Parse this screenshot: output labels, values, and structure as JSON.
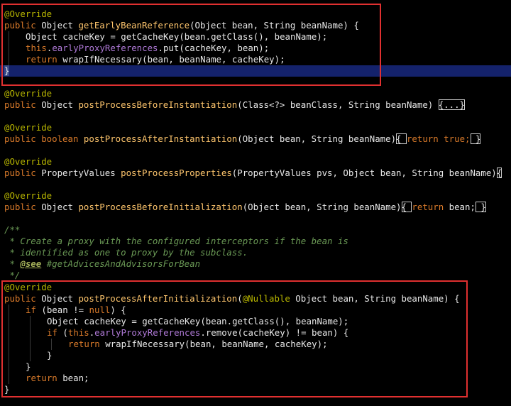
{
  "code": {
    "l1": "@Override",
    "l2_public": "public ",
    "l2_type": "Object ",
    "l2_name": "getEarlyBeanReference",
    "l2_rest": "(Object bean, String beanName) {",
    "l3_a": "Object cacheKey = ",
    "l3_fn": "getCacheKey",
    "l3_b": "(bean.getClass(), beanName);",
    "l4_this": "this",
    "l4_dot": ".",
    "l4_field": "earlyProxyReferences",
    "l4_rest": ".put(cacheKey, bean);",
    "l5_ret": "return ",
    "l5_rest": "wrapIfNecessary(bean, beanName, cacheKey);",
    "l6": "}",
    "l7": "@Override",
    "l8_public": "public ",
    "l8_type": "Object ",
    "l8_name": "postProcessBeforeInstantiation",
    "l8_rest": "(Class<?> beanClass, String beanName) ",
    "l8_fold": "{...}",
    "l9": "@Override",
    "l10_public": "public ",
    "l10_type": "boolean ",
    "l10_name": "postProcessAfterInstantiation",
    "l10_rest": "(Object bean, String beanName)",
    "l10_fold1": "{ ",
    "l10_ret": "return true;",
    "l10_fold2": " }",
    "l11": "@Override",
    "l12_public": "public ",
    "l12_type": "PropertyValues ",
    "l12_name": "postProcessProperties",
    "l12_rest": "(PropertyValues pvs, Object bean, String beanName)",
    "l12_fold": "{",
    "l13": "@Override",
    "l14_public": "public ",
    "l14_type": "Object ",
    "l14_name": "postProcessBeforeInitialization",
    "l14_rest": "(Object bean, String beanName)",
    "l14_fold1": "{ ",
    "l14_ret": "return ",
    "l14_bean": "bean;",
    "l14_fold2": " }",
    "c1": "/**",
    "c2": " * Create a proxy with the configured interceptors if the bean is",
    "c3": " * identified as one to proxy by the subclass.",
    "c4_star": " * ",
    "c4_tag": "@see",
    "c4_rest": " #getAdvicesAndAdvisorsForBean",
    "c5": " */",
    "l15": "@Override",
    "l16_public": "public ",
    "l16_type": "Object ",
    "l16_name": "postProcessAfterInitialization",
    "l16_paren": "(",
    "l16_ann": "@Nullable",
    "l16_rest": " Object bean, String beanName) {",
    "l17_if": "if ",
    "l17_cond": "(bean != ",
    "l17_null": "null",
    "l17_end": ") {",
    "l18_a": "Object cacheKey = ",
    "l18_fn": "getCacheKey",
    "l18_b": "(bean.getClass(), beanName);",
    "l19_if": "if ",
    "l19_p": "(",
    "l19_this": "this",
    "l19_dot": ".",
    "l19_field": "earlyProxyReferences",
    "l19_rest": ".remove(cacheKey) != bean) {",
    "l20_ret": "return ",
    "l20_rest": "wrapIfNecessary(bean, beanName, cacheKey);",
    "l21": "}",
    "l22": "}",
    "l23_ret": "return ",
    "l23_rest": "bean;",
    "l24": "}"
  },
  "colors": {
    "background": "#000000",
    "annotation": "#b8b600",
    "keyword": "#d97a2a",
    "method": "#ffc66d",
    "field": "#b07ad8",
    "comment": "#6a9955",
    "highlight_box": "#e03030",
    "caret_line": "#14226b"
  }
}
